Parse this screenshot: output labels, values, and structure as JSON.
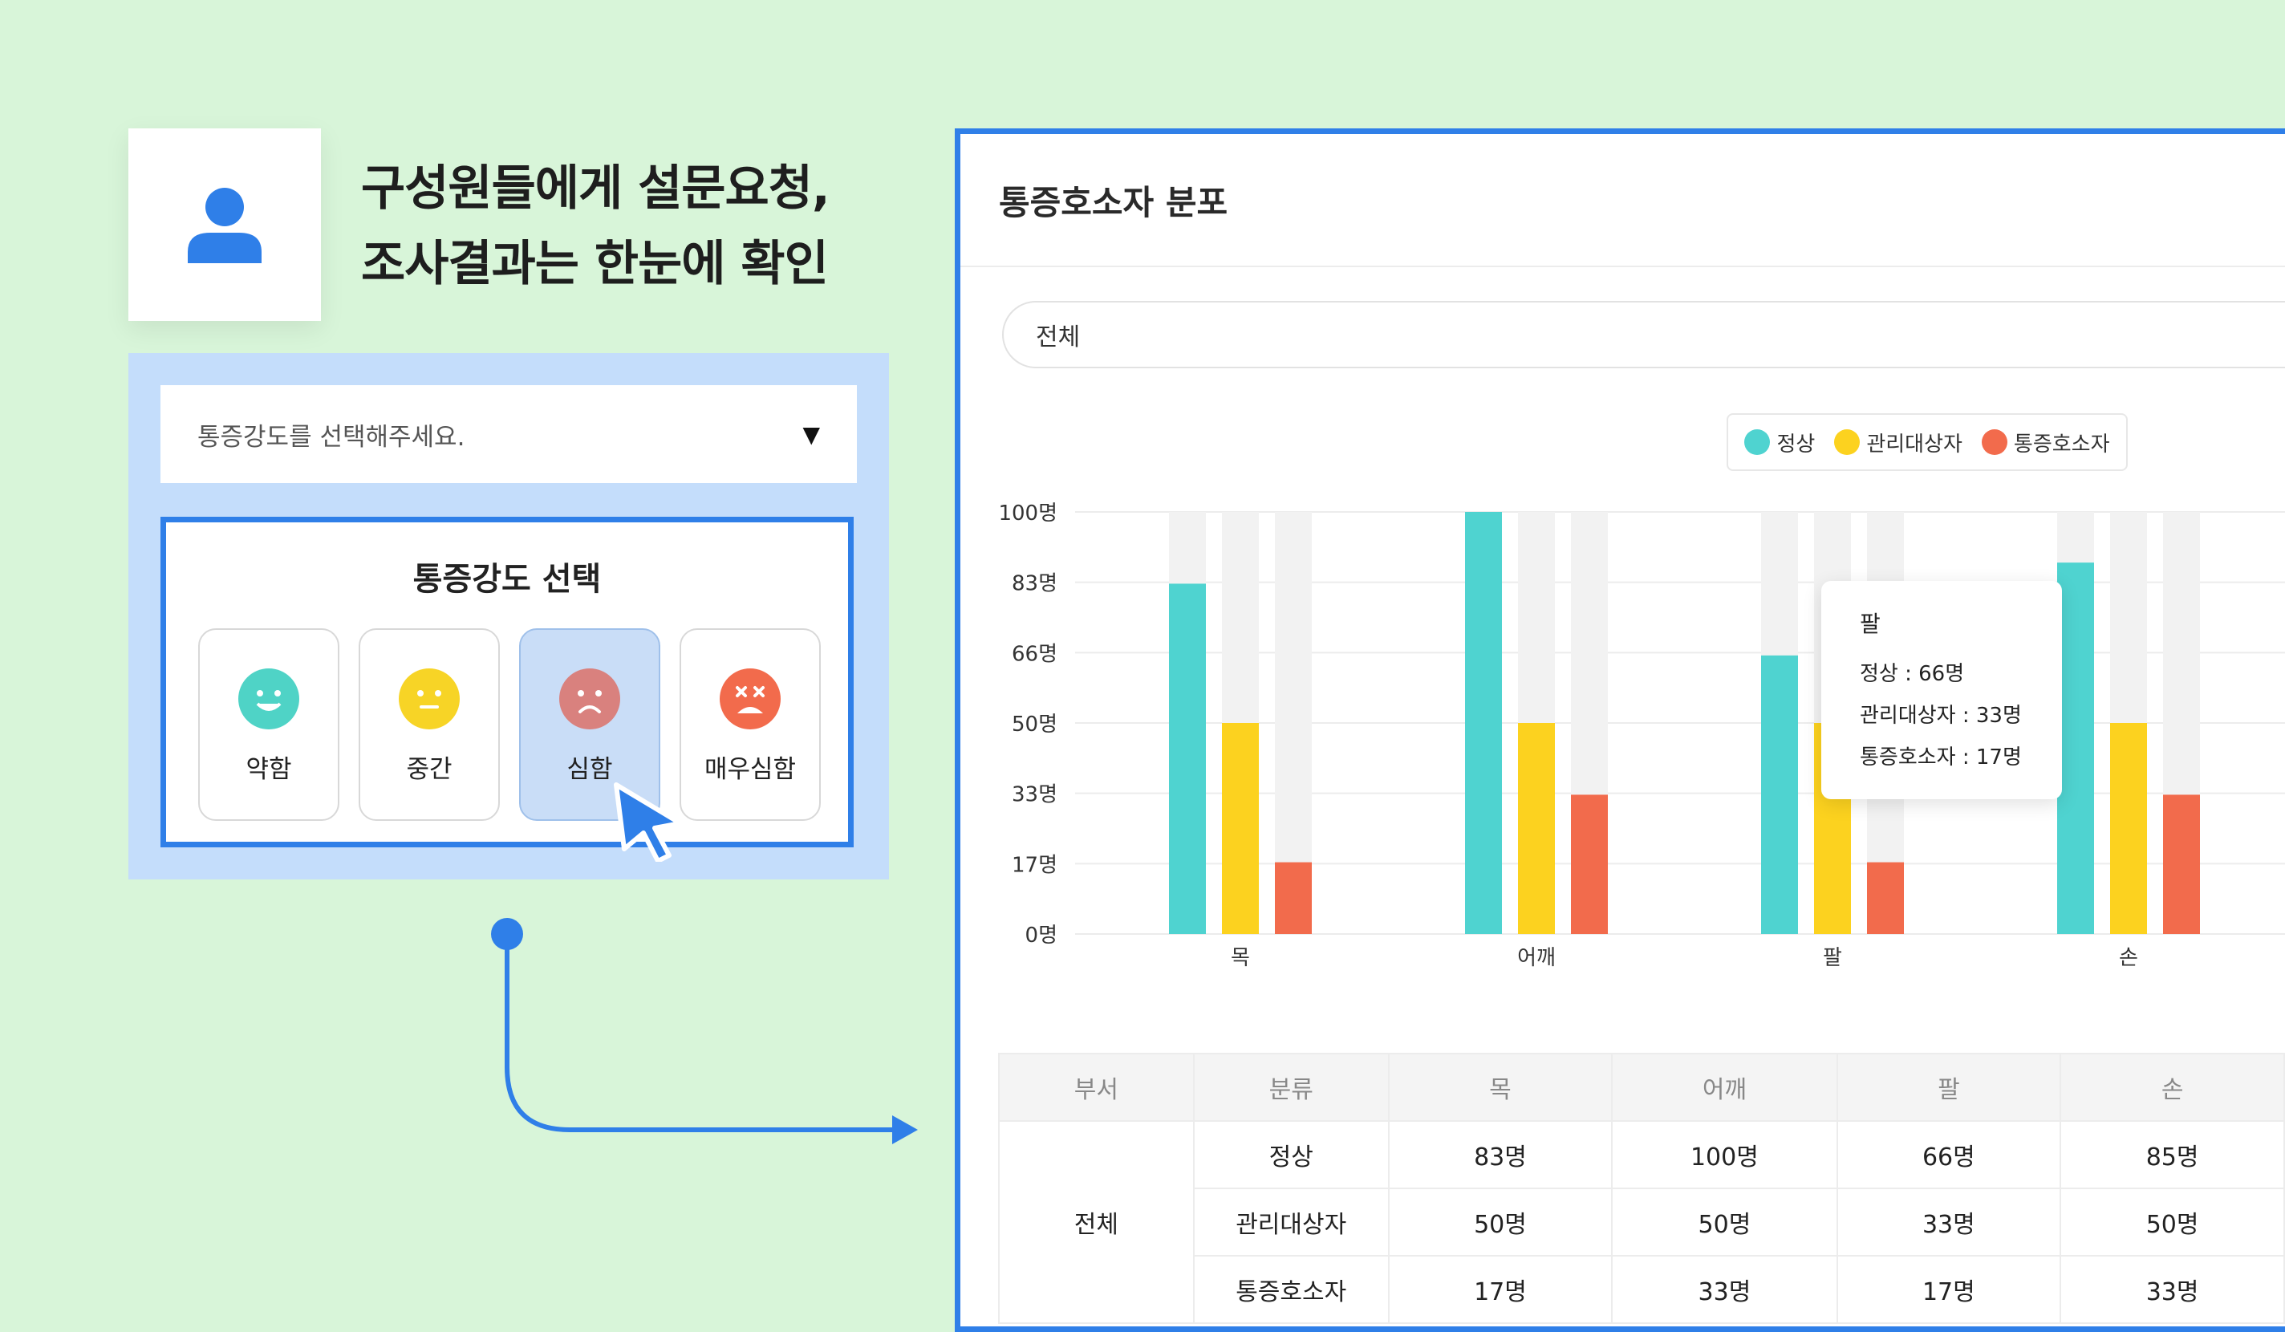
{
  "headline": {
    "line1": "구성원들에게 설문요청,",
    "line2": "조사결과는 한눈에 확인"
  },
  "survey": {
    "dropdown_placeholder": "통증강도를 선택해주세요.",
    "dropdown_arrow": "▼",
    "select_title": "통증강도 선택",
    "options": [
      {
        "label": "약함",
        "color": "#4fd3c6",
        "mood": "happy"
      },
      {
        "label": "중간",
        "color": "#f7d426",
        "mood": "neutral"
      },
      {
        "label": "심함",
        "color": "#d9817e",
        "mood": "sad",
        "selected": true
      },
      {
        "label": "매우심함",
        "color": "#f26b4c",
        "mood": "dizzy"
      }
    ]
  },
  "dashboard": {
    "title": "통증호소자 분포",
    "filter_value": "전체",
    "tooltip": {
      "title": "팔",
      "rows": [
        "정상 : 66명",
        "관리대상자 : 33명",
        "통증호소자 : 17명"
      ]
    },
    "table": {
      "headers": [
        "부서",
        "분류",
        "목",
        "어깨",
        "팔",
        "손"
      ],
      "group": "전체",
      "rows": [
        {
          "category": "정상",
          "values": [
            "83명",
            "100명",
            "66명",
            "85명"
          ]
        },
        {
          "category": "관리대상자",
          "values": [
            "50명",
            "50명",
            "33명",
            "50명"
          ]
        },
        {
          "category": "통증호소자",
          "values": [
            "17명",
            "33명",
            "17명",
            "33명"
          ]
        }
      ]
    }
  },
  "colors": {
    "accent": "#2f7fe8",
    "normal": "#4fd3d0",
    "watch": "#fcd21f",
    "pain": "#f26b4c",
    "track": "#f2f2f2"
  },
  "chart_data": {
    "type": "bar",
    "categories": [
      "목",
      "어깨",
      "팔",
      "손"
    ],
    "series": [
      {
        "name": "정상",
        "values": [
          83,
          100,
          66,
          88
        ]
      },
      {
        "name": "관리대상자",
        "values": [
          50,
          50,
          50,
          50
        ]
      },
      {
        "name": "통증호소자",
        "values": [
          17,
          33,
          17,
          33
        ]
      }
    ],
    "ylim": [
      0,
      100
    ],
    "yticks": [
      "0명",
      "17명",
      "33명",
      "50명",
      "66명",
      "83명",
      "100명"
    ],
    "legend_position": "top",
    "grid": true
  }
}
